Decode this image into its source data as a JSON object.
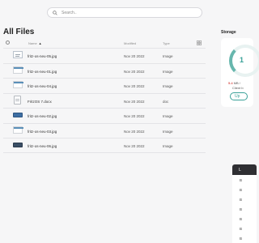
{
  "search": {
    "placeholder": "Search.."
  },
  "page": {
    "title": "All Files"
  },
  "table": {
    "columns": {
      "name": "Name",
      "modified": "Modified",
      "type": "Type"
    },
    "rows": [
      {
        "name": "fritz-os-neu-05.jpg",
        "modified": "Nov 20 2022",
        "type": "Image",
        "thumb": "image-doc"
      },
      {
        "name": "fritz-os-neu-01.jpg",
        "modified": "Nov 20 2022",
        "type": "Image",
        "thumb": "image-screen"
      },
      {
        "name": "fritz-os-neu-04.jpg",
        "modified": "Nov 20 2022",
        "type": "Image",
        "thumb": "image-screen"
      },
      {
        "name": "FritzOS 7.docx",
        "modified": "Nov 20 2022",
        "type": "doc",
        "thumb": "document"
      },
      {
        "name": "fritz-os-neu-02.jpg",
        "modified": "Nov 20 2022",
        "type": "Image",
        "thumb": "image-bar-blue"
      },
      {
        "name": "fritz-os-neu-03.jpg",
        "modified": "Nov 20 2022",
        "type": "Image",
        "thumb": "image-screen"
      },
      {
        "name": "fritz-os-neu-06.jpg",
        "modified": "Nov 20 2022",
        "type": "Image",
        "thumb": "image-bar-dark"
      }
    ]
  },
  "storage": {
    "title": "Storage",
    "ring_value": "1",
    "used_amount": "5.4",
    "used_suffix": "MB /",
    "client_label": "Client b",
    "upgrade_label": "Up",
    "accent": "#3aa198"
  },
  "side_panel": {
    "header": "L",
    "items": [
      "B",
      "B",
      "B",
      "B",
      "B",
      "B",
      "B"
    ]
  }
}
